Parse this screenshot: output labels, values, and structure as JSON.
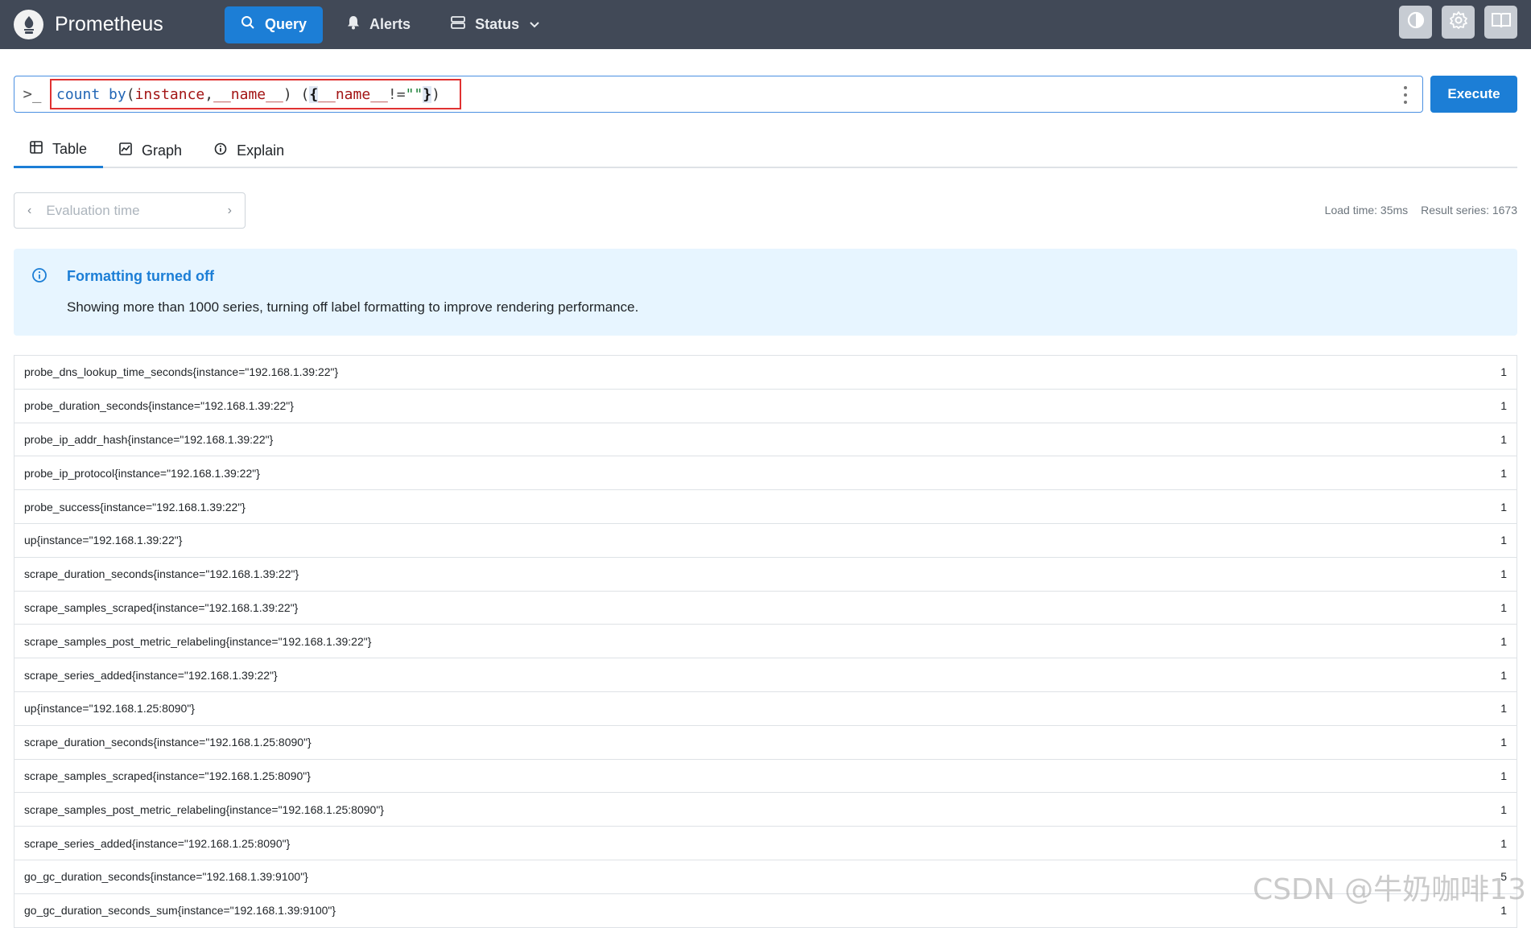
{
  "header": {
    "brand": "Prometheus",
    "nav": [
      {
        "label": "Query",
        "icon": "search-icon",
        "active": true
      },
      {
        "label": "Alerts",
        "icon": "bell-icon"
      },
      {
        "label": "Status",
        "icon": "server-icon",
        "dropdown": true
      }
    ],
    "right_buttons": [
      "theme-toggle-icon",
      "settings-gear-icon",
      "docs-book-icon"
    ]
  },
  "query": {
    "prompt": ">_",
    "tokens": [
      {
        "t": "count",
        "c": "tok-kw"
      },
      {
        "t": " ",
        "c": "tok-p"
      },
      {
        "t": "by",
        "c": "tok-kw"
      },
      {
        "t": "(",
        "c": "tok-p"
      },
      {
        "t": "instance",
        "c": "tok-label"
      },
      {
        "t": ",",
        "c": "tok-p"
      },
      {
        "t": "__name__",
        "c": "tok-label"
      },
      {
        "t": ") (",
        "c": "tok-p"
      },
      {
        "t": "{",
        "c": "tok-brace"
      },
      {
        "t": "__name__",
        "c": "tok-label"
      },
      {
        "t": "!=",
        "c": "tok-op"
      },
      {
        "t": "\"\"",
        "c": "tok-str"
      },
      {
        "t": "}",
        "c": "tok-brace"
      },
      {
        "t": ")",
        "c": "tok-p"
      }
    ],
    "execute_label": "Execute",
    "accent": "#1c7ed6"
  },
  "tabs": [
    {
      "label": "Table",
      "icon": "table-icon",
      "active": true
    },
    {
      "label": "Graph",
      "icon": "graph-icon"
    },
    {
      "label": "Explain",
      "icon": "info-icon"
    }
  ],
  "evaluation": {
    "placeholder": "Evaluation time"
  },
  "stats": {
    "load_time": "Load time: 35ms",
    "result_series": "Result series: 1673"
  },
  "alert": {
    "title": "Formatting turned off",
    "body": "Showing more than 1000 series, turning off label formatting to improve rendering performance."
  },
  "results": [
    {
      "metric": "probe_dns_lookup_time_seconds{instance=\"192.168.1.39:22\"}",
      "value": "1"
    },
    {
      "metric": "probe_duration_seconds{instance=\"192.168.1.39:22\"}",
      "value": "1"
    },
    {
      "metric": "probe_ip_addr_hash{instance=\"192.168.1.39:22\"}",
      "value": "1"
    },
    {
      "metric": "probe_ip_protocol{instance=\"192.168.1.39:22\"}",
      "value": "1"
    },
    {
      "metric": "probe_success{instance=\"192.168.1.39:22\"}",
      "value": "1"
    },
    {
      "metric": "up{instance=\"192.168.1.39:22\"}",
      "value": "1"
    },
    {
      "metric": "scrape_duration_seconds{instance=\"192.168.1.39:22\"}",
      "value": "1"
    },
    {
      "metric": "scrape_samples_scraped{instance=\"192.168.1.39:22\"}",
      "value": "1"
    },
    {
      "metric": "scrape_samples_post_metric_relabeling{instance=\"192.168.1.39:22\"}",
      "value": "1"
    },
    {
      "metric": "scrape_series_added{instance=\"192.168.1.39:22\"}",
      "value": "1"
    },
    {
      "metric": "up{instance=\"192.168.1.25:8090\"}",
      "value": "1"
    },
    {
      "metric": "scrape_duration_seconds{instance=\"192.168.1.25:8090\"}",
      "value": "1"
    },
    {
      "metric": "scrape_samples_scraped{instance=\"192.168.1.25:8090\"}",
      "value": "1"
    },
    {
      "metric": "scrape_samples_post_metric_relabeling{instance=\"192.168.1.25:8090\"}",
      "value": "1"
    },
    {
      "metric": "scrape_series_added{instance=\"192.168.1.25:8090\"}",
      "value": "1"
    },
    {
      "metric": "go_gc_duration_seconds{instance=\"192.168.1.39:9100\"}",
      "value": "5"
    },
    {
      "metric": "go_gc_duration_seconds_sum{instance=\"192.168.1.39:9100\"}",
      "value": "1"
    }
  ],
  "watermark": "CSDN @牛奶咖啡13"
}
